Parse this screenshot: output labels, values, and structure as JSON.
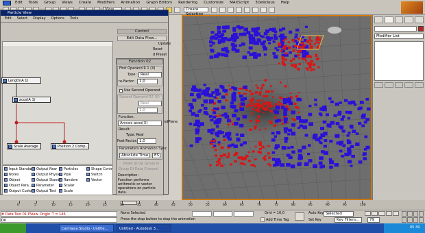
{
  "menubar": {
    "items": [
      "Edit",
      "Tools",
      "Group",
      "Views",
      "Create",
      "Modifiers",
      "Animation",
      "Graph Editors",
      "Rendering",
      "Customize",
      "MAXScript",
      "3Delicious",
      "Help"
    ]
  },
  "toolbar": {
    "view_select": "View",
    "selection_set": "Create Selection Se"
  },
  "particle_view": {
    "title": "Particle View",
    "menu": [
      "Edit",
      "Select",
      "Display",
      "Options",
      "Tools"
    ],
    "nodes": [
      {
        "label": "Length(A 1)"
      },
      {
        "label": "acos(A 1)"
      },
      {
        "label": "Scale Average"
      },
      {
        "label": "Position 2 Comp..."
      }
    ],
    "depot": {
      "col1": [
        "Input Standard",
        "Notes",
        "Object",
        "Object Para...",
        "Output Custom"
      ],
      "col2": [
        "Output New",
        "Output Physx",
        "Output Standard",
        "Parameter",
        "Output Test"
      ],
      "col3": [
        "Particles",
        "Pipe",
        "Random",
        "Scalar",
        "Scale"
      ],
      "col4": [
        "Shape Contr...",
        "Switch",
        "Vector"
      ]
    },
    "control_header": "Control",
    "edit_data_flow": "Edit Data Flow...",
    "sidebar_labels": {
      "update": "Update",
      "reset": "Reset",
      "preset": "d Preset",
      "andplane": "ndPlane"
    },
    "function": {
      "header": "Function 02",
      "first_operand_title": "First Operand R 1 (X)",
      "type_label": "Type:",
      "type_value": "Real",
      "scale_label": "re-Factor:",
      "scale_value": "1,0",
      "use_second": "Use Second Operand",
      "second_operand_title": "Second Operand R2 (X)",
      "type2_value": "Real",
      "scale2_value": "1,0",
      "function_label": "Function:",
      "function_value": "Arccos acos(X)",
      "result_label": "Result:",
      "result_type": "Type: Real",
      "post_factor_label": "Post-Factor:",
      "post_factor_value": "1,0",
      "anim_sync_title": "Parameters Animation Sync",
      "anim_sync_value": "Absolute Time",
      "anim_sync_btn": "ES",
      "reset_at": "Reset at Op Group In",
      "data_channel": "Group DI Data Channel",
      "description_label": "Description:",
      "description": "Function performs arithmetic or vector operations on particle data."
    }
  },
  "viewport": {
    "label": "Perspective"
  },
  "command_panel": {
    "modifier_list": "Modifier List"
  },
  "timeline": {
    "slider_label": "0 / 100",
    "ticks": [
      "0",
      "5",
      "10",
      "15",
      "20",
      "25",
      "30",
      "35",
      "40",
      "45",
      "50",
      "55",
      "60",
      "65",
      "70",
      "75",
      "80",
      "85",
      "90",
      "95",
      "100"
    ]
  },
  "status": {
    "listener": "# Data Test 01.PView_Origin_T = 146",
    "listener2": "OK",
    "none_selected": "None Selected",
    "prompt": "Press the stop button to stop the animation",
    "grid_label": "Grid = 10,0",
    "add_time_tag": "Add Time Tag",
    "auto_key": "Auto Key",
    "selected": "Selected",
    "set_key": "Set Key",
    "key_filters": "Key Filters...",
    "frame": "79"
  },
  "taskbar": {
    "items": [
      "Camtasia Studio - Untitle...",
      "Untitled - Autodesk 3..."
    ],
    "clock": "05:39"
  },
  "colors": {
    "blue_particles": "#2a10d8",
    "red_particles": "#d81616",
    "viewport_bg": "#6e6e6e",
    "selected_frame": "#e07b00"
  }
}
